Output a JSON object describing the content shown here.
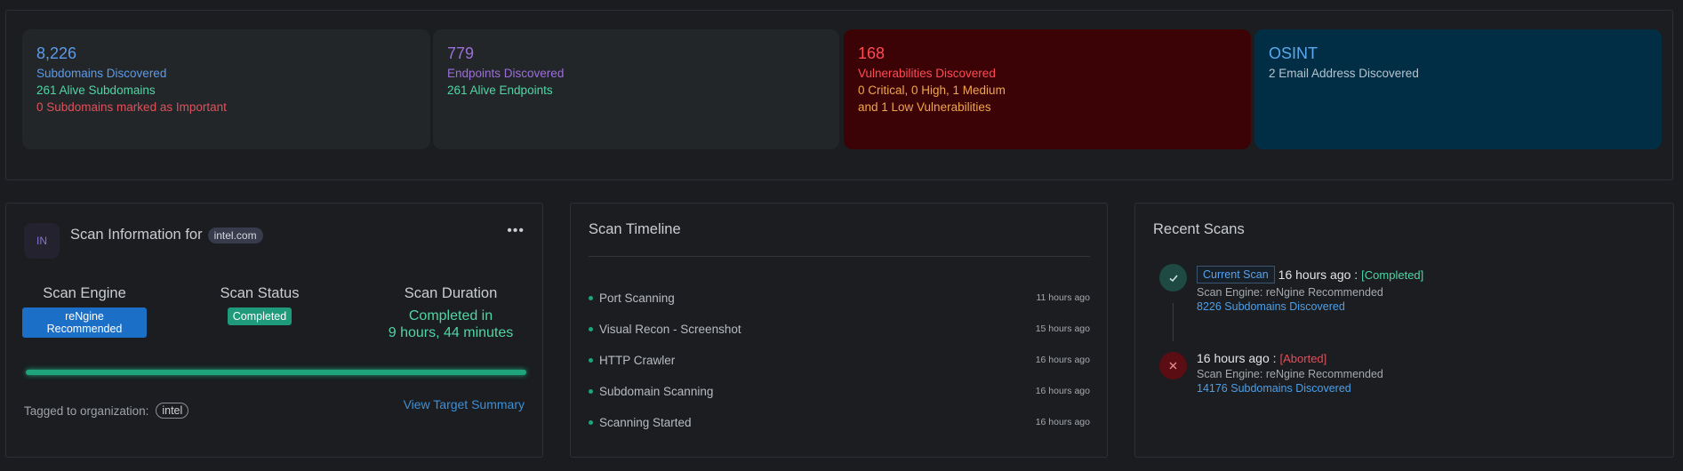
{
  "stats": {
    "subdomains": {
      "count": "8,226",
      "label": "Subdomains Discovered",
      "alive": "261 Alive Subdomains",
      "important": "0 Subdomains marked as Important"
    },
    "endpoints": {
      "count": "779",
      "label": "Endpoints Discovered",
      "alive": "261 Alive Endpoints"
    },
    "vulnerabilities": {
      "count": "168",
      "label": "Vulnerabilities Discovered",
      "breakdown1": "0 Critical, 0 High, 1 Medium",
      "breakdown2": "and 1 Low Vulnerabilities"
    },
    "osint": {
      "title": "OSINT",
      "emails": "2 Email Address Discovered"
    }
  },
  "scan_info": {
    "avatar": "IN",
    "title": "Scan Information for",
    "domain": "intel.com",
    "engine_heading": "Scan Engine",
    "engine_value": "reNgine Recommended",
    "status_heading": "Scan Status",
    "status_value": "Completed",
    "duration_heading": "Scan Duration",
    "duration_line1": "Completed in",
    "duration_line2": "9 hours, 44 minutes",
    "progress_percent": 100,
    "org_label": "Tagged to organization:",
    "org_value": "intel",
    "view_target": "View Target Summary",
    "more_icon": "ellipsis-icon"
  },
  "timeline": {
    "title": "Scan Timeline",
    "items": [
      {
        "label": "Port Scanning",
        "time": "11 hours ago"
      },
      {
        "label": "Visual Recon - Screenshot",
        "time": "15 hours ago"
      },
      {
        "label": "HTTP Crawler",
        "time": "16 hours ago"
      },
      {
        "label": "Subdomain Scanning",
        "time": "16 hours ago"
      },
      {
        "label": "Scanning Started",
        "time": "16 hours ago"
      }
    ]
  },
  "recent_scans": {
    "title": "Recent Scans",
    "scans": [
      {
        "current_label": "Current Scan",
        "time": "16 hours ago :",
        "status": "[Completed]",
        "engine": "Scan Engine: reNgine Recommended",
        "subdomains": "8226 Subdomains Discovered",
        "icon": "check-icon"
      },
      {
        "time": "16 hours ago :",
        "status": "[Aborted]",
        "engine": "Scan Engine: reNgine Recommended",
        "subdomains": "14176 Subdomains Discovered",
        "icon": "x-icon"
      }
    ]
  },
  "colors": {
    "blue": "#5b9be8",
    "purple": "#9b6fd9",
    "green": "#4fd6a4",
    "red": "#e0505a",
    "vuln_yellow": "#f0a64a",
    "vuln_bg": "#3b0306",
    "osint_bg": "#022e45"
  }
}
